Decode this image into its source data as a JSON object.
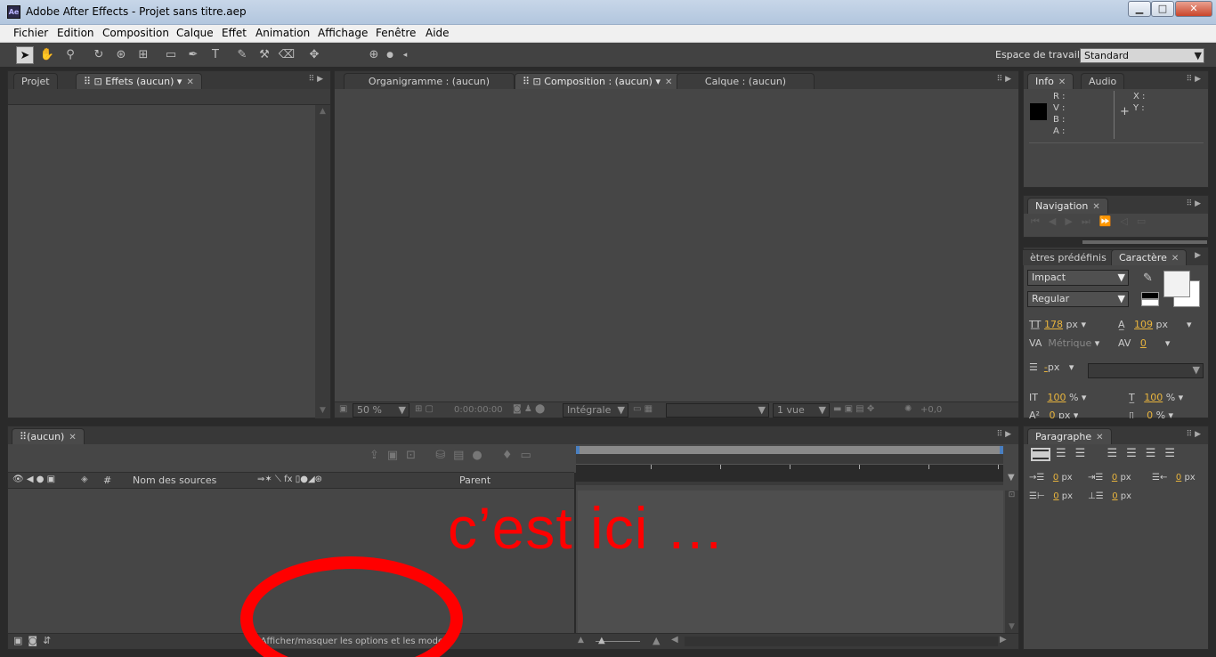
{
  "window": {
    "title": "Adobe After Effects - Projet sans titre.aep",
    "app_icon": "Ae",
    "min": "▁",
    "max": "□",
    "close": "✕"
  },
  "menu": [
    "Fichier",
    "Edition",
    "Composition",
    "Calque",
    "Effet",
    "Animation",
    "Affichage",
    "Fenêtre",
    "Aide"
  ],
  "toolbar": {
    "workspace_label": "Espace de travail :",
    "workspace_value": "Standard"
  },
  "left_panel": {
    "tab_project": "Projet",
    "tab_effects": "Effets (aucun)"
  },
  "center_panel": {
    "tab_flowchart": "Organigramme : (aucun)",
    "tab_composition": "Composition : (aucun)",
    "tab_layer": "Calque : (aucun)",
    "zoom": "50 %",
    "timecode": "0:00:00:00",
    "resolution": "Intégrale",
    "views": "1 vue",
    "exposure": "+0,0"
  },
  "info_panel": {
    "tab_info": "Info",
    "tab_audio": "Audio",
    "r": "R :",
    "v": "V :",
    "b": "B :",
    "a": "A :",
    "x": "X :",
    "y": "Y :"
  },
  "nav_panel": {
    "tab": "Navigation"
  },
  "char_panel": {
    "tab_presets": "ètres prédéfinis",
    "tab_char": "Caractère",
    "font": "Impact",
    "style": "Regular",
    "size": "178",
    "size_unit": "px",
    "leading": "109",
    "leading_unit": "px",
    "kerning": "Métrique",
    "tracking": "0",
    "stroke": "-",
    "stroke_unit": "px",
    "vscale": "100",
    "vscale_unit": "%",
    "hscale": "100",
    "hscale_unit": "%",
    "baseline": "0",
    "baseline_unit": "px",
    "tsume": "0",
    "tsume_unit": "%"
  },
  "para_panel": {
    "tab": "Paragraphe",
    "indent_left": "0",
    "indent_first": "0",
    "indent_right": "0",
    "space_before": "0",
    "space_after": "0",
    "unit": "px"
  },
  "timeline": {
    "tab": "(aucun)",
    "col_num": "#",
    "col_source": "Nom des sources",
    "col_parent": "Parent",
    "toggle_modes": "Afficher/masquer les options et les modes"
  },
  "annotation": {
    "text": "c’est ici …",
    "color": "#ff0000"
  }
}
